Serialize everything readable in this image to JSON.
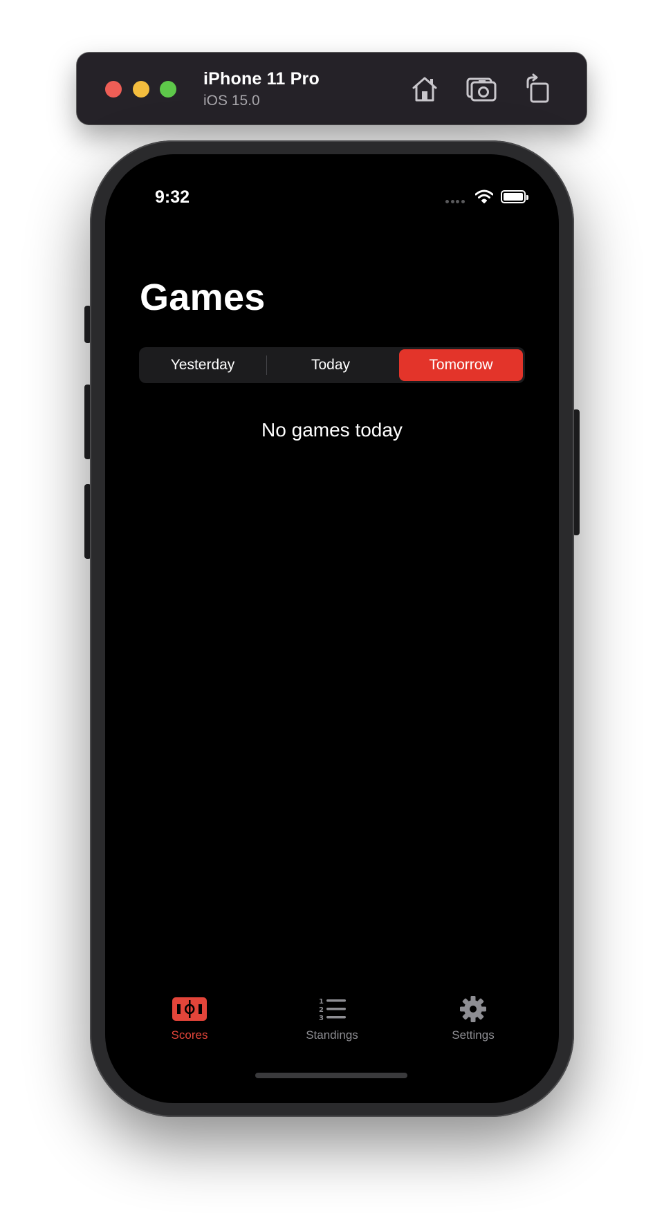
{
  "simulator": {
    "device_name": "iPhone 11 Pro",
    "os_version": "iOS 15.0",
    "buttons": {
      "home": "home-icon",
      "screenshot": "camera-icon",
      "rotate": "rotate-icon"
    },
    "traffic_lights": {
      "close": "#ee5e56",
      "minimize": "#f4bd3e",
      "zoom": "#5ec84a"
    }
  },
  "status_bar": {
    "time": "9:32"
  },
  "page": {
    "title": "Games",
    "segments": [
      "Yesterday",
      "Today",
      "Tomorrow"
    ],
    "selected_segment": "Tomorrow",
    "empty_message": "No games today"
  },
  "tab_bar": {
    "items": [
      {
        "label": "Scores",
        "icon": "soccer-field-icon",
        "active": true
      },
      {
        "label": "Standings",
        "icon": "numbered-list-icon",
        "active": false
      },
      {
        "label": "Settings",
        "icon": "gear-icon",
        "active": false
      }
    ]
  },
  "colors": {
    "accent": "#e3342a",
    "background": "#000000",
    "inactive_tab": "#8e8e93"
  }
}
